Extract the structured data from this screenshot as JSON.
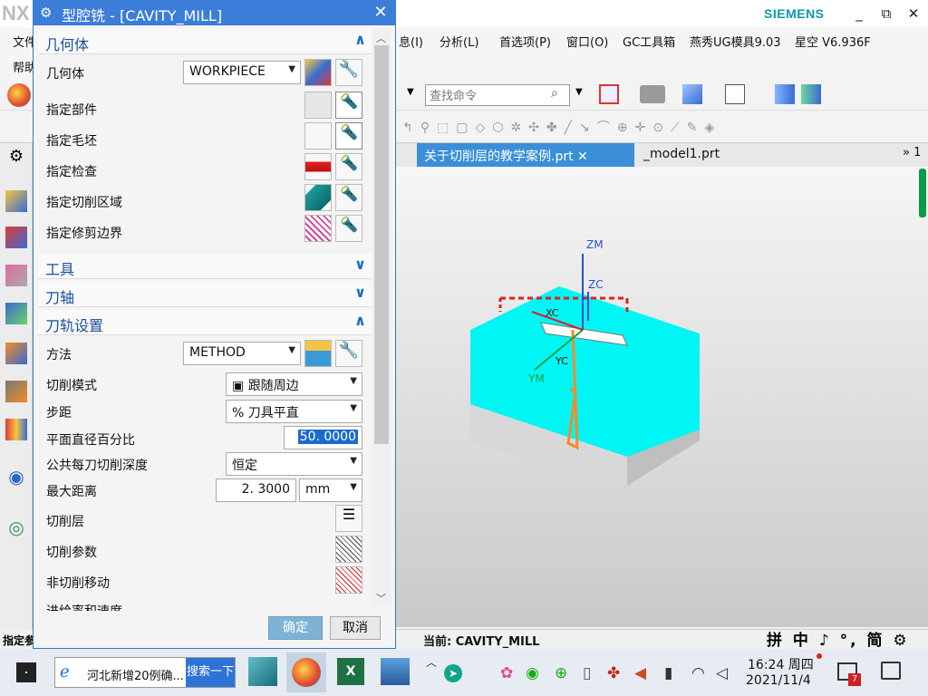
{
  "nx": {
    "logo": "NX",
    "brand": "SIEMENS",
    "window_controls": [
      "_",
      "⧉",
      "✕"
    ],
    "menu": [
      "文件",
      "息(I)",
      "分析(L)",
      "首选项(P)",
      "窗口(O)",
      "GC工具箱",
      "燕秀UG模具9.03",
      "星空 V6.936F"
    ],
    "help": "帮助",
    "search_placeholder": "查找命令",
    "tabs": {
      "active": "关于切削层的教学案例.prt",
      "second": "_model1.prt",
      "more": "» 1"
    },
    "status_current": "当前:  CAVITY_MILL",
    "left_status": "指定参",
    "ime": "拼 中 ♪ °, 简 ⚙ ⋮"
  },
  "dialog": {
    "title": "型腔铣 - [CAVITY_MILL]",
    "close": "✕",
    "sections": {
      "geometry": "几何体",
      "tool": "工具",
      "axis": "刀轴",
      "path": "刀轨设置"
    },
    "geometry_rows": {
      "geometry_label": "几何体",
      "geometry_value": "WORKPIECE",
      "part": "指定部件",
      "blank": "指定毛坯",
      "check": "指定检查",
      "cut_area": "指定切削区域",
      "trim": "指定修剪边界"
    },
    "path_rows": {
      "method_label": "方法",
      "method_value": "METHOD",
      "cut_mode_label": "切削模式",
      "cut_mode_value": "跟随周边",
      "stepover_label": "步距",
      "stepover_value": "% 刀具平直",
      "percent_label": "平面直径百分比",
      "percent_value": "50. 0000",
      "depth_label": "公共每刀切削深度",
      "depth_value": "恒定",
      "max_dist_label": "最大距离",
      "max_dist_value": "2. 3000",
      "max_dist_unit": "mm",
      "levels": "切削层",
      "params": "切削参数",
      "noncut": "非切削移动",
      "feeds": "进给率和速度"
    },
    "ok": "确定",
    "cancel": "取消"
  },
  "view": {
    "axes": [
      "ZM",
      "ZC",
      "XC",
      "YC",
      "YM"
    ]
  },
  "taskbar": {
    "browser_text": "河北新增20例确...",
    "search_btn": "搜索一下",
    "time": "16:24 周四",
    "date": "2021/11/4",
    "notif_count": "7"
  }
}
